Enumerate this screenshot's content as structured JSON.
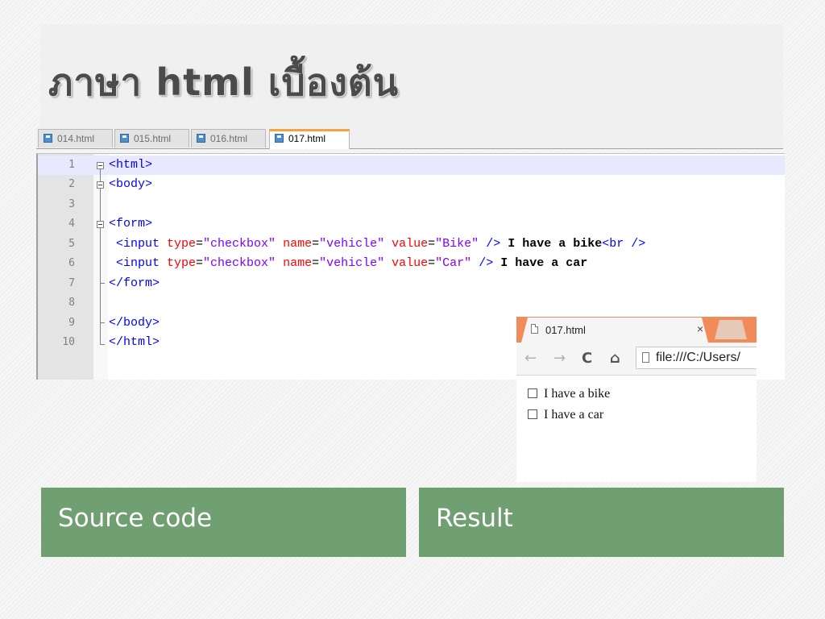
{
  "slide": {
    "title": "ภาษา html เบื้องต้น"
  },
  "editor": {
    "tabs": [
      {
        "label": "014.html"
      },
      {
        "label": "015.html"
      },
      {
        "label": "016.html"
      },
      {
        "label": "017.html",
        "active": true
      }
    ],
    "line_numbers": [
      "1",
      "2",
      "3",
      "4",
      "5",
      "6",
      "7",
      "8",
      "9",
      "10"
    ],
    "lines": [
      {
        "segments": [
          {
            "t": "tag",
            "s": "<html>"
          }
        ]
      },
      {
        "segments": [
          {
            "t": "tag",
            "s": "<body>"
          }
        ]
      },
      {
        "segments": []
      },
      {
        "segments": [
          {
            "t": "tag",
            "s": "<form>"
          }
        ]
      },
      {
        "segments": [
          {
            "t": "tag",
            "s": " <input "
          },
          {
            "t": "attr",
            "s": "type"
          },
          {
            "t": "eq",
            "s": "="
          },
          {
            "t": "val",
            "s": "\"checkbox\""
          },
          {
            "t": "eq",
            "s": " "
          },
          {
            "t": "attr",
            "s": "name"
          },
          {
            "t": "eq",
            "s": "="
          },
          {
            "t": "val",
            "s": "\"vehicle\""
          },
          {
            "t": "eq",
            "s": " "
          },
          {
            "t": "attr",
            "s": "value"
          },
          {
            "t": "eq",
            "s": "="
          },
          {
            "t": "val",
            "s": "\"Bike\""
          },
          {
            "t": "tag",
            "s": " />"
          },
          {
            "t": "text",
            "s": " I have a bike"
          },
          {
            "t": "tag",
            "s": "<br />"
          }
        ]
      },
      {
        "segments": [
          {
            "t": "tag",
            "s": " <input "
          },
          {
            "t": "attr",
            "s": "type"
          },
          {
            "t": "eq",
            "s": "="
          },
          {
            "t": "val",
            "s": "\"checkbox\""
          },
          {
            "t": "eq",
            "s": " "
          },
          {
            "t": "attr",
            "s": "name"
          },
          {
            "t": "eq",
            "s": "="
          },
          {
            "t": "val",
            "s": "\"vehicle\""
          },
          {
            "t": "eq",
            "s": " "
          },
          {
            "t": "attr",
            "s": "value"
          },
          {
            "t": "eq",
            "s": "="
          },
          {
            "t": "val",
            "s": "\"Car\""
          },
          {
            "t": "tag",
            "s": " />"
          },
          {
            "t": "text",
            "s": " I have a car"
          }
        ]
      },
      {
        "segments": [
          {
            "t": "tag",
            "s": "</form>"
          }
        ]
      },
      {
        "segments": []
      },
      {
        "segments": [
          {
            "t": "tag",
            "s": "</body>"
          }
        ]
      },
      {
        "segments": [
          {
            "t": "tag",
            "s": "</html>"
          }
        ]
      }
    ],
    "colors": {
      "tag": "#0000ff",
      "attr": "#ff0000",
      "value": "#8000ff",
      "highlight": "#e8e8ff"
    }
  },
  "browser": {
    "tab_title": "017.html",
    "close_glyph": "×",
    "url": "file:///C:/Users/",
    "nav_icons": [
      "back-arrow-icon",
      "forward-arrow-icon",
      "reload-icon",
      "home-icon"
    ],
    "checkboxes": [
      {
        "label": "I have a bike",
        "checked": false
      },
      {
        "label": "I have a car",
        "checked": false
      }
    ]
  },
  "captions": {
    "source": "Source code",
    "result": "Result"
  },
  "theme": {
    "caption_green": "#70a072",
    "tab_accent": "#f9a23c",
    "browser_strip": "#f28b5a"
  }
}
